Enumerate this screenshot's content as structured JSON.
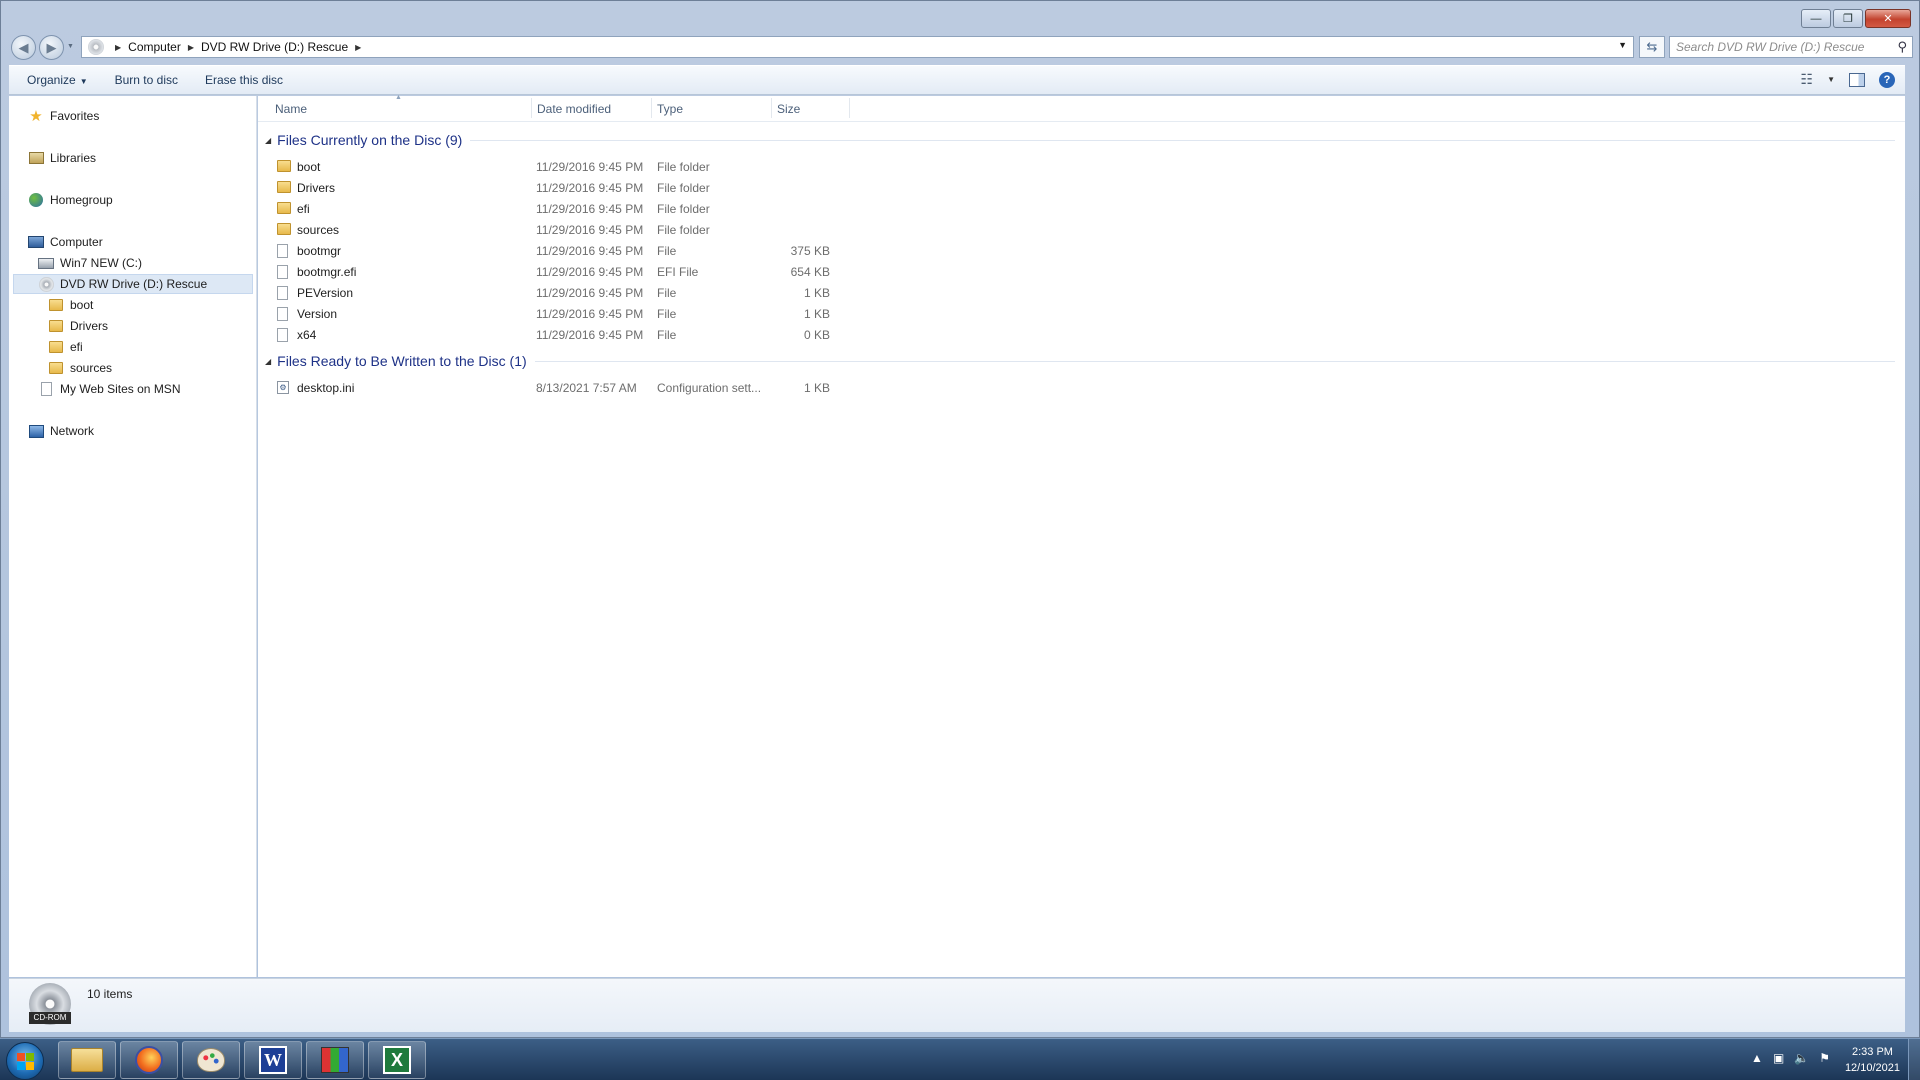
{
  "window": {
    "minimize_label": "—",
    "maximize_label": "❐",
    "close_label": "✕"
  },
  "address": {
    "crumbs": [
      "Computer",
      "DVD RW Drive (D:) Rescue"
    ],
    "search_placeholder": "Search DVD RW Drive (D:) Rescue"
  },
  "toolbar": {
    "organize": "Organize",
    "burn": "Burn to disc",
    "erase": "Erase this disc"
  },
  "nav": {
    "favorites": "Favorites",
    "libraries": "Libraries",
    "homegroup": "Homegroup",
    "computer": "Computer",
    "win7": "Win7 NEW (C:)",
    "dvd": "DVD RW Drive (D:) Rescue",
    "boot": "boot",
    "drivers": "Drivers",
    "efi": "efi",
    "sources": "sources",
    "mywebsites": "My Web Sites on MSN",
    "network": "Network"
  },
  "columns": {
    "name": "Name",
    "date": "Date modified",
    "type": "Type",
    "size": "Size"
  },
  "groups": [
    {
      "title": "Files Currently on the Disc (9)",
      "rows": [
        {
          "name": "boot",
          "date": "11/29/2016 9:45 PM",
          "type": "File folder",
          "size": "",
          "icon": "folder-icon"
        },
        {
          "name": "Drivers",
          "date": "11/29/2016 9:45 PM",
          "type": "File folder",
          "size": "",
          "icon": "folder-icon"
        },
        {
          "name": "efi",
          "date": "11/29/2016 9:45 PM",
          "type": "File folder",
          "size": "",
          "icon": "folder-icon"
        },
        {
          "name": "sources",
          "date": "11/29/2016 9:45 PM",
          "type": "File folder",
          "size": "",
          "icon": "folder-icon"
        },
        {
          "name": "bootmgr",
          "date": "11/29/2016 9:45 PM",
          "type": "File",
          "size": "375 KB",
          "icon": "file-icon"
        },
        {
          "name": "bootmgr.efi",
          "date": "11/29/2016 9:45 PM",
          "type": "EFI File",
          "size": "654 KB",
          "icon": "file-icon"
        },
        {
          "name": "PEVersion",
          "date": "11/29/2016 9:45 PM",
          "type": "File",
          "size": "1 KB",
          "icon": "file-icon"
        },
        {
          "name": "Version",
          "date": "11/29/2016 9:45 PM",
          "type": "File",
          "size": "1 KB",
          "icon": "file-icon"
        },
        {
          "name": "x64",
          "date": "11/29/2016 9:45 PM",
          "type": "File",
          "size": "0 KB",
          "icon": "file-icon"
        }
      ]
    },
    {
      "title": "Files Ready to Be Written to the Disc (1)",
      "rows": [
        {
          "name": "desktop.ini",
          "date": "8/13/2021 7:57 AM",
          "type": "Configuration sett...",
          "size": "1 KB",
          "icon": "config-file-icon"
        }
      ]
    }
  ],
  "details": {
    "drive_badge": "CD-ROM",
    "items": "10 items"
  },
  "taskbar": {
    "word_letter": "W",
    "excel_letter": "X",
    "time": "2:33 PM",
    "date": "12/10/2021"
  },
  "colors": {
    "group_title": "#1e3287",
    "selection": "#dde8f5"
  }
}
